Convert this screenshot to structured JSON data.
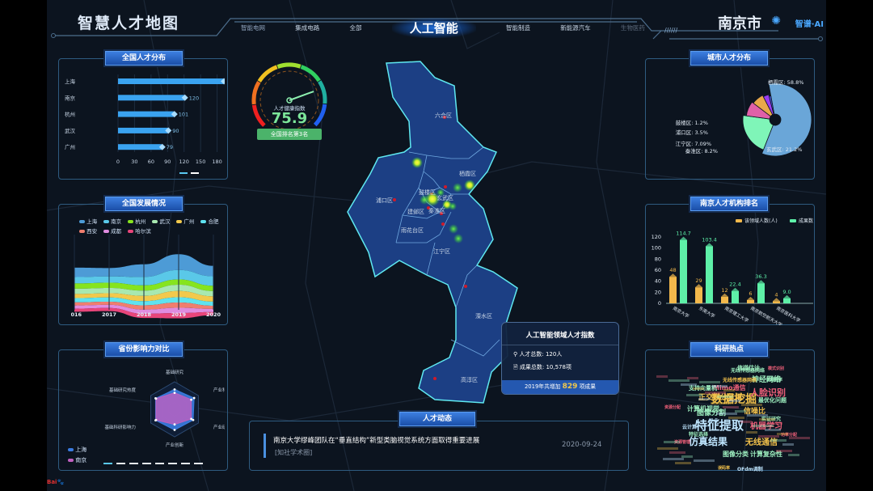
{
  "header": {
    "title": "智慧人才地图",
    "city": "南京市",
    "brand": "智谱·AI",
    "tabs": [
      "智能电网",
      "集成电路",
      "全部",
      "人工智能",
      "智能制造",
      "新能源汽车",
      "生物医药"
    ],
    "active_tab": "人工智能"
  },
  "gauge": {
    "label": "人才健康指数",
    "value": "75.9",
    "rank": "全国排名第3名",
    "fraction": 0.759
  },
  "national_distribution": {
    "title": "全国人才分布",
    "unit": "人",
    "chart_data": {
      "type": "bar",
      "orientation": "horizontal",
      "categories": [
        "上海",
        "南京",
        "杭州",
        "武汉",
        "广州"
      ],
      "values": [
        191,
        120,
        101,
        90,
        79
      ],
      "xlim": [
        0,
        210
      ],
      "xticks": [
        "0",
        "30",
        "60",
        "90",
        "120",
        "150",
        "180",
        "210"
      ]
    }
  },
  "national_development": {
    "title": "全国发展情况",
    "chart_data": {
      "type": "area",
      "stacked": true,
      "x": [
        "2016",
        "2017",
        "2018",
        "2019",
        "2020"
      ],
      "series": [
        {
          "name": "上海",
          "color": "#4d9bd6",
          "values": [
            9,
            8,
            12,
            15,
            10
          ]
        },
        {
          "name": "南京",
          "color": "#5ac8e8",
          "values": [
            6,
            6,
            8,
            9,
            9
          ]
        },
        {
          "name": "杭州",
          "color": "#86e41e",
          "values": [
            5,
            5,
            5,
            5,
            5
          ]
        },
        {
          "name": "武汉",
          "color": "#a8e8b0",
          "values": [
            5,
            5,
            5,
            6,
            5
          ]
        },
        {
          "name": "广州",
          "color": "#f2c94c",
          "values": [
            4,
            4,
            5,
            6,
            5
          ]
        },
        {
          "name": "合肥",
          "color": "#5ee3f0",
          "values": [
            4,
            4,
            4,
            5,
            4
          ]
        },
        {
          "name": "西安",
          "color": "#f07e6e",
          "values": [
            3,
            3,
            4,
            5,
            3
          ]
        },
        {
          "name": "成都",
          "color": "#e08ce0",
          "values": [
            3,
            3,
            4,
            5,
            3
          ]
        },
        {
          "name": "哈尔滨",
          "color": "#e8457a",
          "values": [
            3,
            3,
            4,
            5,
            3
          ]
        }
      ]
    }
  },
  "province_influence": {
    "title": "省份影响力对比",
    "chart_data": {
      "type": "radar",
      "axes": [
        "基础研究",
        "产业科研影响力",
        "产业研究热度",
        "产业创新",
        "基础科研影响力",
        "基础研究热度"
      ],
      "series": [
        {
          "name": "上海",
          "color": "#3a7be0",
          "values": [
            0.72,
            0.82,
            0.78,
            0.75,
            0.8,
            0.8
          ]
        },
        {
          "name": "南京",
          "color": "#c060c0",
          "values": [
            0.6,
            0.7,
            0.7,
            0.55,
            0.78,
            0.78
          ]
        }
      ]
    }
  },
  "map": {
    "districts": [
      "六合区",
      "栖霞区",
      "浦口区",
      "鼓楼区",
      "玄武区",
      "建邺区",
      "秦淮区",
      "雨花台区",
      "江宁区",
      "溧水区",
      "高淳区"
    ]
  },
  "popup": {
    "title": "人工智能领域人才指数",
    "talent_total": "人才总数: 120人",
    "result_total": "成果总数: 10,578项",
    "footer_pre": "2019年共增加",
    "footer_num": "829",
    "footer_post": "项成果"
  },
  "news": {
    "title": "人才动态",
    "headline": "南京大学缪峰团队在“垂直结构”新型类脑视觉系统方面取得重要进展",
    "source": "[知社学术圈]",
    "date": "2020-09-24"
  },
  "city_distribution": {
    "title": "城市人才分布",
    "chart_data": {
      "type": "pie",
      "labels": [
        "栖霞区: 58.8%",
        "玄武区: 21.2%",
        "秦淮区: 8.2%",
        "江宁区: 7.09%",
        "浦口区: 3.5%",
        "鼓楼区: 1.2%"
      ],
      "values": [
        58.8,
        21.2,
        8.2,
        7.09,
        3.5,
        1.2
      ],
      "colors": [
        "#6aa6d8",
        "#7ff5b8",
        "#e060a8",
        "#e8a84a",
        "#9a3cf0",
        "#4a5ae0"
      ]
    }
  },
  "institution_ranking": {
    "title": "南京人才机构排名",
    "chart_data": {
      "type": "bar",
      "categories": [
        "南京大学",
        "东南大学",
        "南京理工大学",
        "南京航空航天大学",
        "南京医科大学"
      ],
      "series": [
        {
          "name": "该领域人数(人)",
          "color": "#f2b84b",
          "values": [
            48,
            29,
            12,
            6,
            4
          ]
        },
        {
          "name": "成果数量(百)",
          "color": "#5ef0a8",
          "values": [
            114.7,
            103.4,
            22.4,
            36.3,
            9.0
          ]
        }
      ],
      "ylim": [
        0,
        120
      ],
      "yticks": [
        "0",
        "20",
        "40",
        "60",
        "80",
        "100",
        "120"
      ]
    }
  },
  "research_hotspots": {
    "title": "科研热点",
    "words": [
      {
        "t": "特征提取",
        "c": "#bfe6ff",
        "s": 15
      },
      {
        "t": "数据挖掘",
        "c": "#f2c14b",
        "s": 14
      },
      {
        "t": "仿真结果",
        "c": "#bfe6ff",
        "s": 12
      },
      {
        "t": "人脸识别",
        "c": "#f0607a",
        "s": 11
      },
      {
        "t": "机器学习",
        "c": "#f0607a",
        "s": 10
      },
      {
        "t": "无线通信",
        "c": "#f2c14b",
        "s": 10
      },
      {
        "t": "正交频分复用",
        "c": "#f2c14b",
        "s": 9
      },
      {
        "t": "神经网络",
        "c": "#9ef0c0",
        "s": 9
      },
      {
        "t": "图像分割",
        "c": "#9ef0c0",
        "s": 9
      },
      {
        "t": "计算机视觉",
        "c": "#9ef0c0",
        "s": 8
      },
      {
        "t": "信噪比",
        "c": "#f2c14b",
        "s": 9
      },
      {
        "t": "图像分类",
        "c": "#9ef0c0",
        "s": 8
      },
      {
        "t": "计算复杂性",
        "c": "#9ef0c0",
        "s": 8
      },
      {
        "t": "Mimo通信",
        "c": "#f0607a",
        "s": 8
      },
      {
        "t": "支持向量机",
        "c": "#9ef0c0",
        "s": 7
      },
      {
        "t": "信道估计",
        "c": "#9ef0c0",
        "s": 7
      },
      {
        "t": "最优化问题",
        "c": "#9ef0c0",
        "s": 7
      },
      {
        "t": "云计算",
        "c": "#bfe6ff",
        "s": 6
      },
      {
        "t": "优化",
        "c": "#bfe6ff",
        "s": 7
      },
      {
        "t": "实证研究",
        "c": "#9ef0c0",
        "s": 6
      },
      {
        "t": "无线传感器网络",
        "c": "#f2c14b",
        "s": 6
      },
      {
        "t": "无线传感器网络",
        "c": "#9ef0c0",
        "s": 6
      },
      {
        "t": "OFdm调制",
        "c": "#bfe6ff",
        "s": 6
      },
      {
        "t": "特征选择",
        "c": "#9ef0c0",
        "s": 6
      },
      {
        "t": "资源管理",
        "c": "#f0607a",
        "s": 5
      },
      {
        "t": "误码率",
        "c": "#f2c14b",
        "s": 5
      },
      {
        "t": "功率分配",
        "c": "#f0607a",
        "s": 5
      },
      {
        "t": "模式识别",
        "c": "#f0607a",
        "s": 5
      },
      {
        "t": "能源效率",
        "c": "#9ef0c0",
        "s": 5
      },
      {
        "t": "资源分配",
        "c": "#f0607a",
        "s": 5
      }
    ]
  }
}
